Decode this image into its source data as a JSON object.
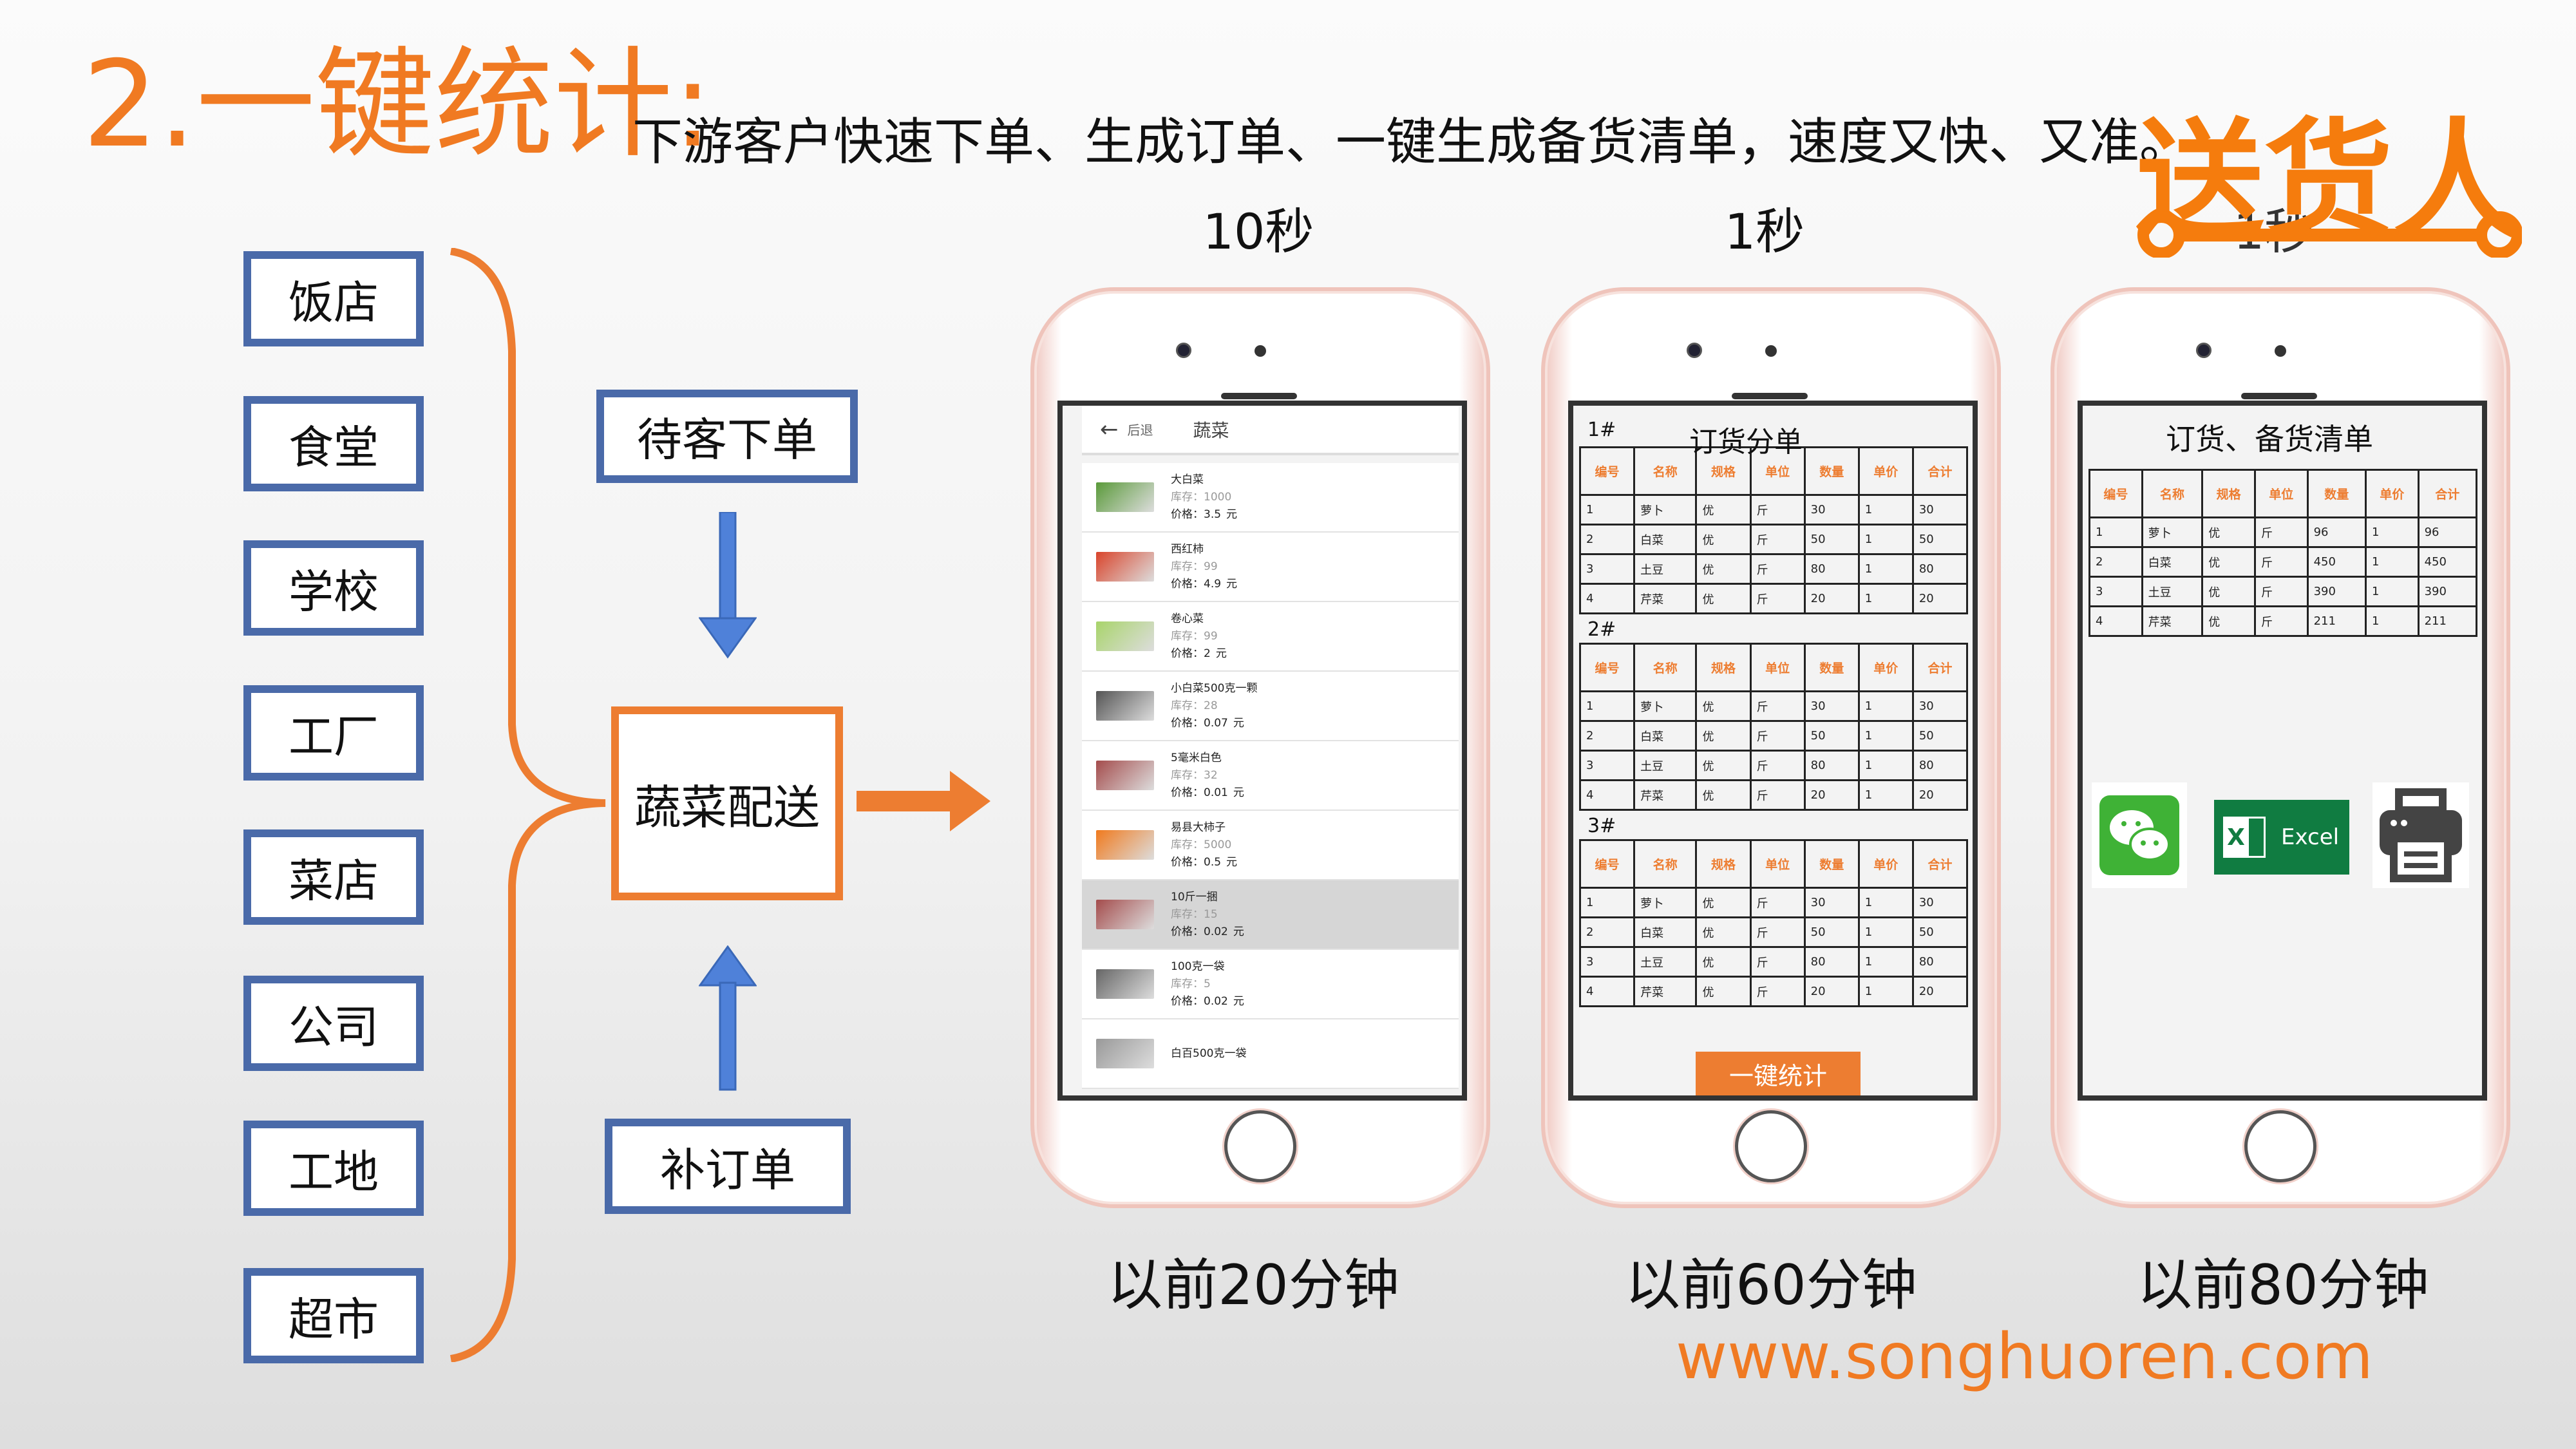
{
  "header": {
    "title": "2.一键统计:",
    "subtitle": "下游客户快速下单、生成订单、一键生成备货清单，速度又快、又准。",
    "logo_text": "送货人"
  },
  "customers": [
    "饭店",
    "食堂",
    "学校",
    "工厂",
    "菜店",
    "公司",
    "工地",
    "超市"
  ],
  "flow": {
    "top": "待客下单",
    "hub": "蔬菜配送",
    "bottom": "补订单"
  },
  "phones": [
    {
      "speed": "10秒",
      "before": "以前20分钟"
    },
    {
      "speed": "1秒",
      "before": "以前60分钟"
    },
    {
      "speed": "1秒",
      "before": "以前80分钟"
    }
  ],
  "phone1": {
    "back": "后退",
    "title": "蔬菜",
    "stock_label": "库存：",
    "price_label": "价格：",
    "unit": "元",
    "items": [
      {
        "name": "大白菜",
        "stock": "1000",
        "price": "3.5",
        "color": "#5a9a3a"
      },
      {
        "name": "西红柿",
        "stock": "99",
        "price": "4.9",
        "color": "#d9442b"
      },
      {
        "name": "卷心菜",
        "stock": "99",
        "price": "2",
        "color": "#a8d46a"
      },
      {
        "name": "小白菜500克一颗",
        "stock": "28",
        "price": "0.07",
        "color": "#555"
      },
      {
        "name": "5毫米白色",
        "stock": "32",
        "price": "0.01",
        "color": "#a44c4c"
      },
      {
        "name": "易县大柿子",
        "stock": "5000",
        "price": "0.5",
        "color": "#f07a1e"
      },
      {
        "name": "10斤一捆",
        "stock": "15",
        "price": "0.02",
        "color": "#a44c4c",
        "selected": true
      },
      {
        "name": "100克一袋",
        "stock": "5",
        "price": "0.02",
        "color": "#666"
      },
      {
        "name": "白百500克一袋",
        "stock": "",
        "price": "",
        "color": "#999"
      }
    ]
  },
  "phone2": {
    "title": "订货分单",
    "button": "一键统计",
    "columns": [
      "编号",
      "名称",
      "规格",
      "单位",
      "数量",
      "单价",
      "合计"
    ],
    "sections": [
      {
        "label": "1#",
        "rows": [
          [
            "1",
            "萝卜",
            "优",
            "斤",
            "30",
            "1",
            "30"
          ],
          [
            "2",
            "白菜",
            "优",
            "斤",
            "50",
            "1",
            "50"
          ],
          [
            "3",
            "土豆",
            "优",
            "斤",
            "80",
            "1",
            "80"
          ],
          [
            "4",
            "芹菜",
            "优",
            "斤",
            "20",
            "1",
            "20"
          ]
        ]
      },
      {
        "label": "2#",
        "rows": [
          [
            "1",
            "萝卜",
            "优",
            "斤",
            "30",
            "1",
            "30"
          ],
          [
            "2",
            "白菜",
            "优",
            "斤",
            "50",
            "1",
            "50"
          ],
          [
            "3",
            "土豆",
            "优",
            "斤",
            "80",
            "1",
            "80"
          ],
          [
            "4",
            "芹菜",
            "优",
            "斤",
            "20",
            "1",
            "20"
          ]
        ]
      },
      {
        "label": "3#",
        "rows": [
          [
            "1",
            "萝卜",
            "优",
            "斤",
            "30",
            "1",
            "30"
          ],
          [
            "2",
            "白菜",
            "优",
            "斤",
            "50",
            "1",
            "50"
          ],
          [
            "3",
            "土豆",
            "优",
            "斤",
            "80",
            "1",
            "80"
          ],
          [
            "4",
            "芹菜",
            "优",
            "斤",
            "20",
            "1",
            "20"
          ]
        ]
      }
    ]
  },
  "phone3": {
    "title": "订货、备货清单",
    "columns": [
      "编号",
      "名称",
      "规格",
      "单位",
      "数量",
      "单价",
      "合计"
    ],
    "rows": [
      [
        "1",
        "萝卜",
        "优",
        "斤",
        "96",
        "1",
        "96"
      ],
      [
        "2",
        "白菜",
        "优",
        "斤",
        "450",
        "1",
        "450"
      ],
      [
        "3",
        "土豆",
        "优",
        "斤",
        "390",
        "1",
        "390"
      ],
      [
        "4",
        "芹菜",
        "优",
        "斤",
        "211",
        "1",
        "211"
      ]
    ],
    "share": {
      "wechat": "wechat-icon",
      "excel_label": "Excel",
      "printer": "printer-icon"
    }
  },
  "footer": {
    "url": "www.songhuoren.com"
  },
  "colors": {
    "accent": "#ed7d31",
    "box_border": "#4a6aa9",
    "excel": "#107c41",
    "wechat": "#3fb236"
  }
}
